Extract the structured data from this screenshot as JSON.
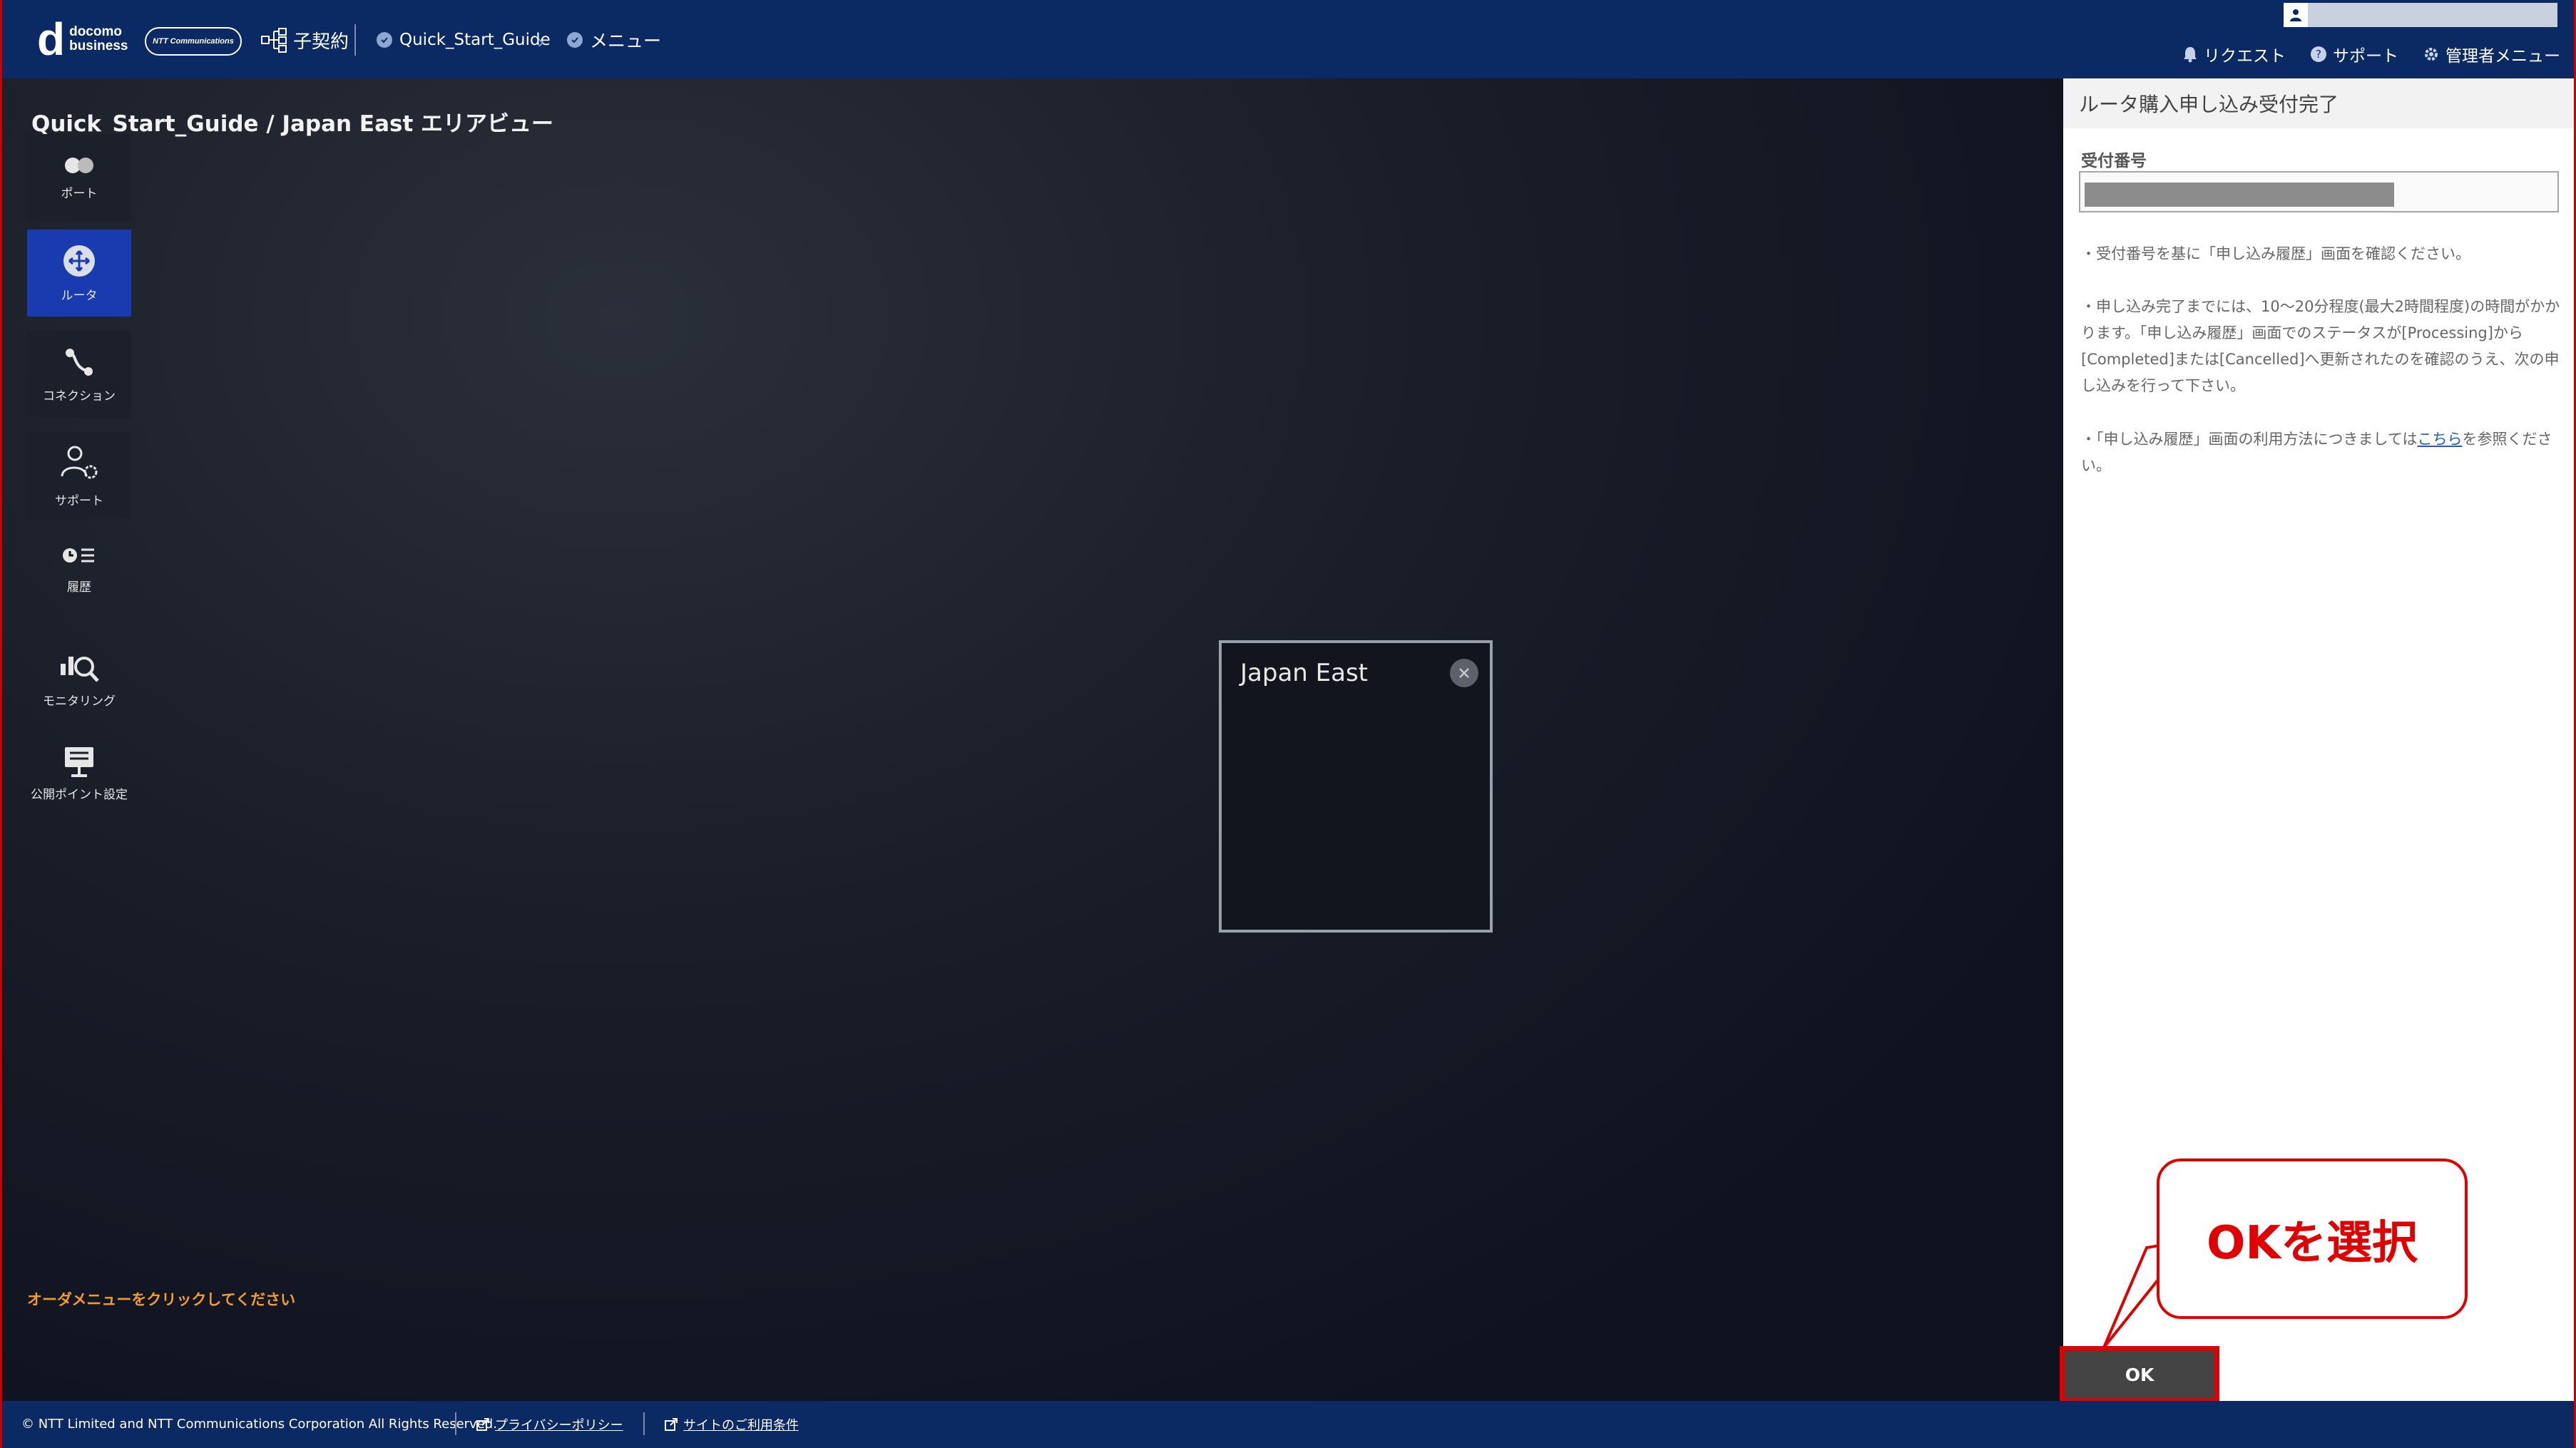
{
  "header": {
    "logo_line1": "docomo",
    "logo_line2": "business",
    "logo_ntt": "NTT Communications",
    "breadcrumb_sub": "子契約",
    "breadcrumb_guide": "Quick_Start_Guide",
    "breadcrumb_menu": "メニュー",
    "link_request": "リクエスト",
    "link_support": "サポート",
    "link_admin": "管理者メニュー"
  },
  "main": {
    "title": "Quick_Start_Guide / Japan East エリアビュー",
    "sidebar": [
      {
        "label": "ポート"
      },
      {
        "label": "ルータ"
      },
      {
        "label": "コネクション"
      },
      {
        "label": "サポート"
      },
      {
        "label": "履歴"
      },
      {
        "label": "モニタリング"
      },
      {
        "label": "公開ポイント設定"
      }
    ],
    "order_note": "オーダメニューをクリックしてください",
    "area_name": "Japan East"
  },
  "panel": {
    "title": "ルータ購入申し込み受付完了",
    "receipt_label": "受付番号",
    "note1": "・受付番号を基に「申し込み履歴」画面を確認ください。",
    "note2": "・申し込み完了までには、10〜20分程度(最大2時間程度)の時間がかかります。「申し込み履歴」画面でのステータスが[Processing]から[Completed]または[Cancelled]へ更新されたのを確認のうえ、次の申し込みを行って下さい。",
    "note3_pre": "・「申し込み履歴」画面の利用方法につきましては",
    "note3_link": "こちら",
    "note3_post": "を参照ください。",
    "ok_label": "OK"
  },
  "callout": "OKを選択",
  "footer": {
    "copyright": "© NTT Limited and NTT Communications Corporation All Rights Reserved.",
    "privacy": "プライバシーポリシー",
    "terms": "サイトのご利用条件"
  },
  "colors": {
    "header_bg": "#0b2a63",
    "sidebar_active": "#1a3bb0",
    "highlight": "#e00000",
    "note_orange": "#f39b2b"
  }
}
